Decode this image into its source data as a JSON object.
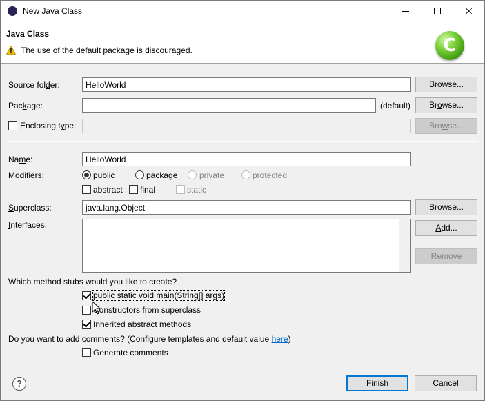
{
  "window": {
    "title": "New Java Class",
    "icon": "eclipse-icon"
  },
  "header": {
    "title": "Java Class",
    "message": "The use of the default package is discouraged.",
    "message_icon": "warning-icon",
    "logo_letter": "C"
  },
  "source_folder": {
    "label_pre": "Source fol",
    "label_key": "d",
    "label_post": "er:",
    "value": "HelloWorld",
    "browse": "Browse..."
  },
  "package": {
    "label_pre": "Pac",
    "label_key": "k",
    "label_post": "age:",
    "value": "",
    "default_text": "(default)",
    "browse": "Browse..."
  },
  "enclosing": {
    "label_pre": "Enclosing t",
    "label_key": "y",
    "label_post": "pe:",
    "value": "",
    "browse": "Browse...",
    "checked": false
  },
  "name": {
    "label_pre": "Na",
    "label_key": "m",
    "label_post": "e:",
    "value": "HelloWorld"
  },
  "modifiers": {
    "label": "Modifiers:",
    "access": [
      {
        "label": "public",
        "checked": true,
        "enabled": true
      },
      {
        "label": "package",
        "checked": false,
        "enabled": true
      },
      {
        "label": "private",
        "checked": false,
        "enabled": false
      },
      {
        "label": "protected",
        "checked": false,
        "enabled": false
      }
    ],
    "other": [
      {
        "label": "abstract",
        "checked": false,
        "enabled": true
      },
      {
        "label": "final",
        "checked": false,
        "enabled": true
      },
      {
        "label": "static",
        "checked": false,
        "enabled": false
      }
    ]
  },
  "superclass": {
    "label_key": "S",
    "label_post": "uperclass:",
    "value": "java.lang.Object",
    "browse": "Browse..."
  },
  "interfaces": {
    "label_key": "I",
    "label_post": "nterfaces:",
    "add": "Add...",
    "remove": "Remove"
  },
  "stubs": {
    "question": "Which method stubs would you like to create?",
    "items": [
      {
        "label": "public static void main(String[] args)",
        "checked": true
      },
      {
        "label": "Constructors from superclass",
        "checked": false
      },
      {
        "label": "Inherited abstract methods",
        "checked": true
      }
    ]
  },
  "comments": {
    "question_pre": "Do you want to add comments? (Configure templates and default value ",
    "link": "here",
    "question_post": ")",
    "generate": {
      "label": "Generate comments",
      "checked": false
    }
  },
  "footer": {
    "help_symbol": "?",
    "finish": "Finish",
    "cancel": "Cancel"
  }
}
